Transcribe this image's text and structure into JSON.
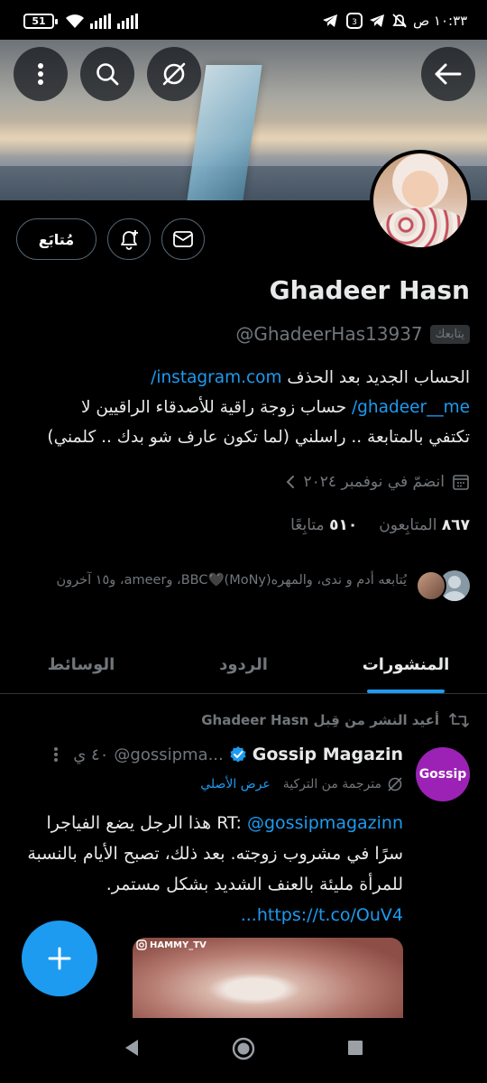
{
  "status_bar": {
    "time": "١٠:٣٣ ص",
    "battery": "51"
  },
  "profile": {
    "name": "Ghadeer Hasn",
    "handle": "@GhadeerHas13937",
    "follows_you_badge": "يتابعك",
    "bio_line1_text": "الحساب الجديد بعد الحذف ",
    "bio_link1": "instagram.com/",
    "bio_link2": "ghadeer__me/",
    "bio_line2_text": " حساب زوجة راقية للأصدقاء الراقيين لا",
    "bio_line3_text": "تكتفي بالمتابعة .. راسلني (لما تكون عارف شو بدك .. كلمني)",
    "joined": "انضمّ في نوفمبر ٢٠٢٤",
    "following_count": "٥١٠",
    "following_label": "متابِعًا",
    "followers_count": "٨٦٧",
    "followers_label": "المتابِعون",
    "followed_by": "يُتابعه أدم و ندى، والمهره(MoNy)🖤BBC، وameer، و١٥ آخرون",
    "subscriptions_button": "مُتابَع"
  },
  "tabs": {
    "posts": "المنشورات",
    "replies": "الردود",
    "media": "الوسائط"
  },
  "tweet": {
    "retweet_note": "أعيد النشر من قِبل Ghadeer Hasn",
    "author_name": "Gossip Magazin",
    "author_handle": "@gossipma...",
    "time": "٤٠ ي",
    "avatar_text": "Gossip",
    "translated_note": "مترجمة من التركية",
    "show_original": "عرض الأصلي",
    "body_prefix": "RT: ",
    "body_mention": "@gossipmagazinn",
    "body_text": " هذا الرجل يضع الفياجرا سرًا في مشروب زوجته. بعد ذلك، تصبح الأيام بالنسبة للمرأة مليئة بالعنف الشديد بشكل مستمر. ",
    "body_link": "https://t.co/OuV4...",
    "media_tag": "HAMMY_TV"
  },
  "icons": {
    "back": "arrow-left-icon",
    "grok": "grok-icon",
    "search": "search-icon",
    "more": "more-vertical-icon",
    "message": "envelope-icon",
    "notify": "bell-plus-icon",
    "calendar": "calendar-icon",
    "retweet": "retweet-icon",
    "verified": "verified-badge-icon",
    "compose": "plus-icon"
  },
  "colors": {
    "accent": "#1d9bf0",
    "background": "#000000",
    "muted_text": "#71767b",
    "gossip_avatar": "#9c22b5"
  }
}
